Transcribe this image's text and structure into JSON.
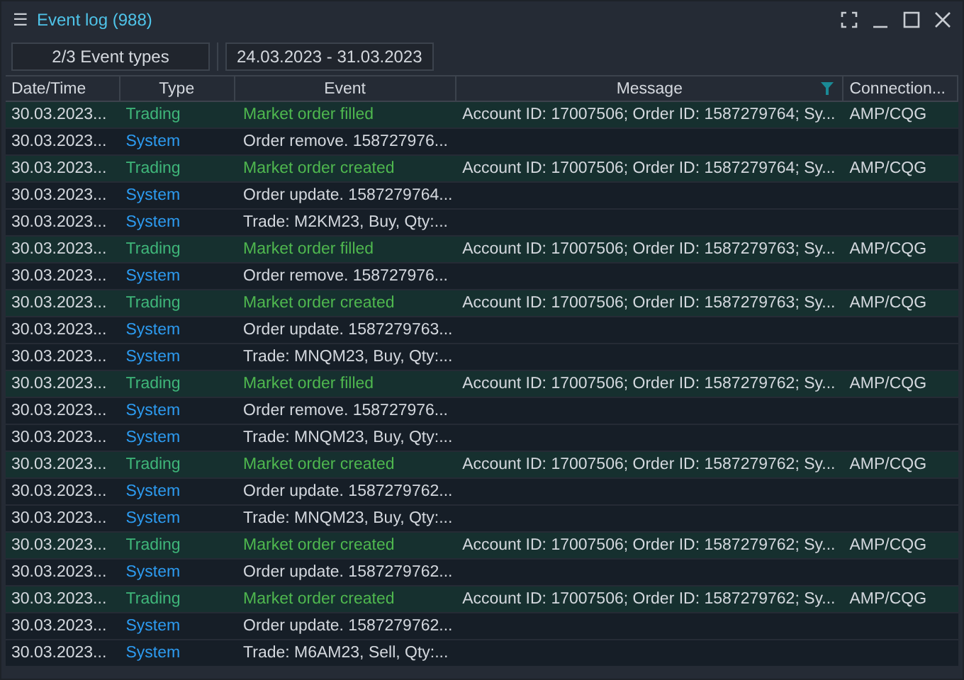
{
  "window": {
    "menu_glyph": "☰",
    "title": "Event log (988)"
  },
  "toolbar": {
    "event_types": "2/3 Event types",
    "date_range": "24.03.2023 - 31.03.2023"
  },
  "table": {
    "columns": [
      {
        "label": "Date/Time",
        "filter": false
      },
      {
        "label": "Type",
        "filter": false
      },
      {
        "label": "Event",
        "filter": false
      },
      {
        "label": "Message",
        "filter": true
      },
      {
        "label": "Connection...",
        "filter": false
      }
    ],
    "rows": [
      {
        "kind": "trading",
        "date": "30.03.2023...",
        "type": "Trading",
        "event": "Market order filled",
        "message": "Account ID: 17007506; Order ID: 1587279764; Sy...",
        "connection": "AMP/CQG"
      },
      {
        "kind": "system",
        "date": "30.03.2023...",
        "type": "System",
        "event": "Order remove. 158727976...",
        "message": "",
        "connection": ""
      },
      {
        "kind": "trading",
        "date": "30.03.2023...",
        "type": "Trading",
        "event": "Market order created",
        "message": "Account ID: 17007506; Order ID: 1587279764; Sy...",
        "connection": "AMP/CQG"
      },
      {
        "kind": "system",
        "date": "30.03.2023...",
        "type": "System",
        "event": "Order update. 1587279764...",
        "message": "",
        "connection": ""
      },
      {
        "kind": "system",
        "date": "30.03.2023...",
        "type": "System",
        "event": "Trade: M2KM23, Buy, Qty:...",
        "message": "",
        "connection": ""
      },
      {
        "kind": "trading",
        "date": "30.03.2023...",
        "type": "Trading",
        "event": "Market order filled",
        "message": "Account ID: 17007506; Order ID: 1587279763; Sy...",
        "connection": "AMP/CQG"
      },
      {
        "kind": "system",
        "date": "30.03.2023...",
        "type": "System",
        "event": "Order remove. 158727976...",
        "message": "",
        "connection": ""
      },
      {
        "kind": "trading",
        "date": "30.03.2023...",
        "type": "Trading",
        "event": "Market order created",
        "message": "Account ID: 17007506; Order ID: 1587279763; Sy...",
        "connection": "AMP/CQG"
      },
      {
        "kind": "system",
        "date": "30.03.2023...",
        "type": "System",
        "event": "Order update. 1587279763...",
        "message": "",
        "connection": ""
      },
      {
        "kind": "system",
        "date": "30.03.2023...",
        "type": "System",
        "event": "Trade: MNQM23, Buy, Qty:...",
        "message": "",
        "connection": ""
      },
      {
        "kind": "trading",
        "date": "30.03.2023...",
        "type": "Trading",
        "event": "Market order filled",
        "message": "Account ID: 17007506; Order ID: 1587279762; Sy...",
        "connection": "AMP/CQG"
      },
      {
        "kind": "system",
        "date": "30.03.2023...",
        "type": "System",
        "event": "Order remove. 158727976...",
        "message": "",
        "connection": ""
      },
      {
        "kind": "system",
        "date": "30.03.2023...",
        "type": "System",
        "event": "Trade: MNQM23, Buy, Qty:...",
        "message": "",
        "connection": ""
      },
      {
        "kind": "trading",
        "date": "30.03.2023...",
        "type": "Trading",
        "event": "Market order created",
        "message": "Account ID: 17007506; Order ID: 1587279762; Sy...",
        "connection": "AMP/CQG"
      },
      {
        "kind": "system",
        "date": "30.03.2023...",
        "type": "System",
        "event": "Order update. 1587279762...",
        "message": "",
        "connection": ""
      },
      {
        "kind": "system",
        "date": "30.03.2023...",
        "type": "System",
        "event": "Trade: MNQM23, Buy, Qty:...",
        "message": "",
        "connection": ""
      },
      {
        "kind": "trading",
        "date": "30.03.2023...",
        "type": "Trading",
        "event": "Market order created",
        "message": "Account ID: 17007506; Order ID: 1587279762; Sy...",
        "connection": "AMP/CQG"
      },
      {
        "kind": "system",
        "date": "30.03.2023...",
        "type": "System",
        "event": "Order update. 1587279762...",
        "message": "",
        "connection": ""
      },
      {
        "kind": "trading",
        "date": "30.03.2023...",
        "type": "Trading",
        "event": "Market order created",
        "message": "Account ID: 17007506; Order ID: 1587279762; Sy...",
        "connection": "AMP/CQG"
      },
      {
        "kind": "system",
        "date": "30.03.2023...",
        "type": "System",
        "event": "Order update. 1587279762...",
        "message": "",
        "connection": ""
      },
      {
        "kind": "system",
        "date": "30.03.2023...",
        "type": "System",
        "event": "Trade: M6AM23, Sell, Qty:...",
        "message": "",
        "connection": ""
      }
    ]
  }
}
